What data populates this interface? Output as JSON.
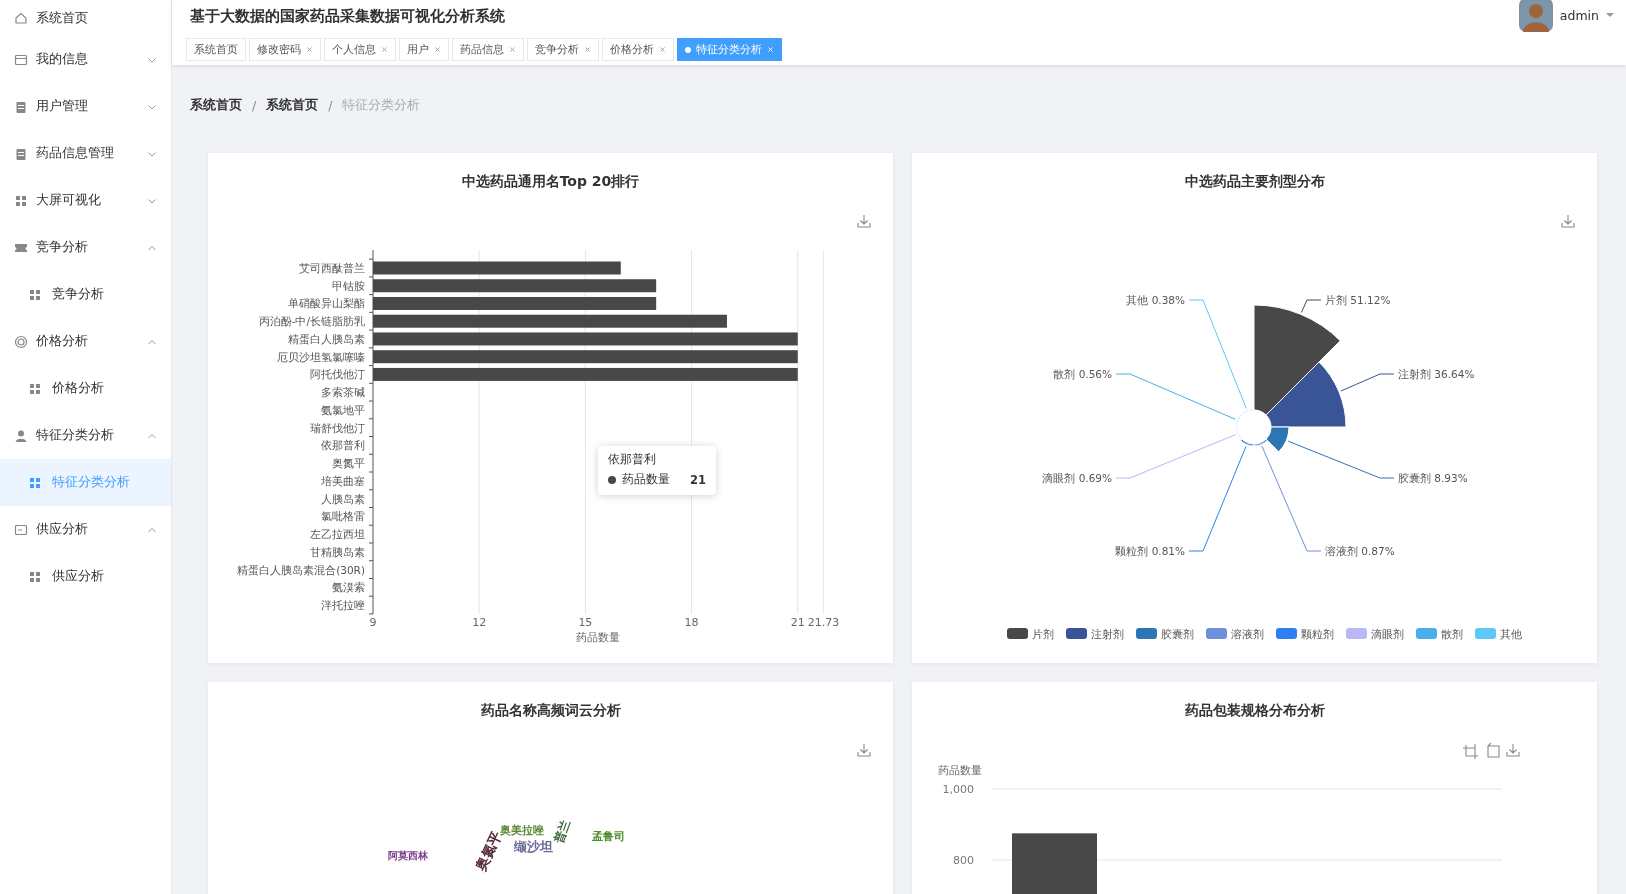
{
  "sidebar": {
    "items": [
      {
        "label": "系统首页",
        "selected": false
      },
      {
        "label": "我的信息",
        "selected": false,
        "expanded": false
      },
      {
        "label": "用户管理",
        "selected": false,
        "expanded": false
      },
      {
        "label": "药品信息管理",
        "selected": false,
        "expanded": false
      },
      {
        "label": "大屏可视化",
        "selected": false,
        "expanded": false
      },
      {
        "label": "竞争分析",
        "selected": false,
        "expanded": true,
        "children": [
          {
            "label": "竞争分析",
            "selected": false
          }
        ]
      },
      {
        "label": "价格分析",
        "selected": false,
        "expanded": true,
        "children": [
          {
            "label": "价格分析",
            "selected": false
          }
        ]
      },
      {
        "label": "特征分类分析",
        "selected": false,
        "expanded": true,
        "children": [
          {
            "label": "特征分类分析",
            "selected": true
          }
        ]
      },
      {
        "label": "供应分析",
        "selected": false,
        "expanded": true,
        "children": [
          {
            "label": "供应分析",
            "selected": false
          }
        ]
      }
    ]
  },
  "header": {
    "title": "基于大数据的国家药品采集数据可视化分析系统",
    "user": "admin"
  },
  "tabs": [
    {
      "label": "系统首页",
      "selected": false,
      "closable": false
    },
    {
      "label": "修改密码",
      "selected": false,
      "closable": true
    },
    {
      "label": "个人信息",
      "selected": false,
      "closable": true
    },
    {
      "label": "用户",
      "selected": false,
      "closable": true
    },
    {
      "label": "药品信息",
      "selected": false,
      "closable": true
    },
    {
      "label": "竞争分析",
      "selected": false,
      "closable": true
    },
    {
      "label": "价格分析",
      "selected": false,
      "closable": true
    },
    {
      "label": "特征分类分析",
      "selected": true,
      "closable": true
    }
  ],
  "breadcrumb": [
    {
      "kind": "link",
      "text": "系统首页"
    },
    {
      "kind": "separator",
      "text": "/"
    },
    {
      "kind": "link",
      "text": "系统首页"
    },
    {
      "kind": "separator",
      "text": "/"
    },
    {
      "kind": "current",
      "text": "特征分类分析"
    }
  ],
  "cards": [
    {
      "kind": "hbar",
      "title": "中选药品通用名Top 20排行",
      "chart_data": {
        "type": "bar",
        "orientation": "horizontal",
        "grid": true,
        "xlabel": "药品数量",
        "categories": [
          "艾司西酞普兰",
          "甲钴胺",
          "单硝酸异山梨酯",
          "丙泊酚-中/长链脂肪乳",
          "精蛋白人胰岛素",
          "厄贝沙坦氢氯噻嗪",
          "阿托伐他汀",
          "多索茶碱",
          "氨氯地平",
          "瑞舒伐他汀",
          "依那普利",
          "奥氮平",
          "培美曲塞",
          "人胰岛素",
          "氯吡格雷",
          "左乙拉西坦",
          "甘精胰岛素",
          "精蛋白人胰岛素混合(30R)",
          "氨溴索",
          "泮托拉唑"
        ],
        "series": [
          {
            "name": "药品数量",
            "color": "#484848",
            "values": [
              16,
              17,
              17,
              19,
              21,
              21,
              21,
              null,
              null,
              null,
              null,
              null,
              null,
              null,
              null,
              null,
              null,
              null,
              null,
              null
            ]
          }
        ],
        "xlim": [
          9,
          21.73
        ],
        "xticks": [
          9,
          12,
          15,
          18,
          21,
          21.73
        ]
      },
      "tooltip": {
        "title": "依那普利",
        "value": "21"
      }
    },
    {
      "kind": "rose",
      "title": "中选药品主要剂型分布",
      "slice_labels": [
        "其他 0.38%",
        "片剂 51.12%",
        "散剂 0.56%",
        "注射剂 36.64%",
        "滴眼剂 0.69%",
        "胶囊剂 8.93%",
        "颗粒剂 0.81%",
        "溶液剂 0.87%"
      ],
      "legend": [
        {
          "label": "片剂",
          "color": "#484848"
        },
        {
          "label": "注射剂",
          "color": "#3a5597"
        },
        {
          "label": "胶囊剂",
          "color": "#2e75b6"
        },
        {
          "label": "溶液剂",
          "color": "#6f8fd8"
        },
        {
          "label": "颗粒剂",
          "color": "#2f7ff0"
        },
        {
          "label": "滴眼剂",
          "color": "#b8b8f8"
        },
        {
          "label": "散剂",
          "color": "#4aaee8"
        },
        {
          "label": "其他",
          "color": "#5ec8f8"
        }
      ]
    },
    {
      "kind": "cloud",
      "title": "药品名称高频词云分析",
      "words": [
        {
          "text": "阿莫西林",
          "color": "#7a3b8f"
        },
        {
          "text": "奥美拉唑",
          "color": "#5a8a3a"
        },
        {
          "text": "缬沙坦",
          "color": "#6a6a9a"
        },
        {
          "text": "孟鲁司",
          "color": "#4f8f2f"
        },
        {
          "text": "普兰",
          "color": "#3d6a3d"
        },
        {
          "text": "奥氮平",
          "color": "#5a2a3a"
        }
      ]
    },
    {
      "kind": "vbar",
      "title": "药品包装规格分布分析",
      "chart_data": {
        "type": "bar",
        "grid": true,
        "ylabel": "药品数量",
        "ylim": [
          704,
          1000
        ],
        "yticks": [
          {
            "value": 800,
            "label": "800"
          },
          {
            "value": 1000,
            "label": "1,000"
          }
        ],
        "series": [
          {
            "color": "#484848",
            "values": [
              875
            ]
          }
        ]
      }
    }
  ]
}
